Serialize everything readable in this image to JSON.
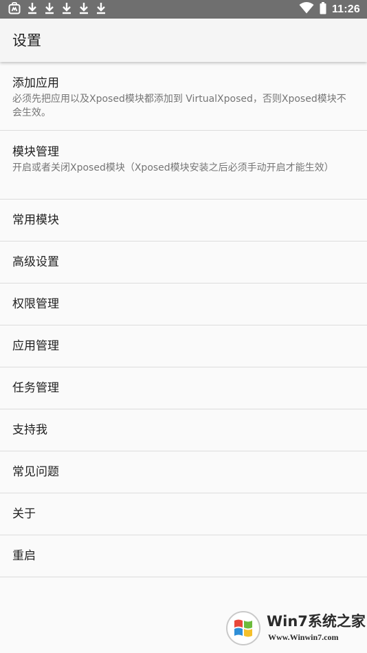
{
  "status_bar": {
    "time": "11:26",
    "icons": [
      "app-notification-icon",
      "download-icon",
      "download-icon",
      "download-icon",
      "download-icon",
      "download-icon",
      "wifi-icon",
      "battery-icon"
    ],
    "background_color": "#6f6f6f"
  },
  "app_bar": {
    "title": "设置"
  },
  "settings": {
    "items": [
      {
        "title": "添加应用",
        "summary": "必须先把应用以及Xposed模块都添加到 VirtualXposed，否则Xposed模块不会生效。"
      },
      {
        "title": "模块管理",
        "summary": "开启或者关闭Xposed模块（Xposed模块安装之后必须手动开启才能生效）"
      },
      {
        "title": "常用模块"
      },
      {
        "title": "高级设置"
      },
      {
        "title": "权限管理"
      },
      {
        "title": "应用管理"
      },
      {
        "title": "任务管理"
      },
      {
        "title": "支持我"
      },
      {
        "title": "常见问题"
      },
      {
        "title": "关于"
      },
      {
        "title": "重启"
      }
    ]
  },
  "watermark": {
    "brand": "Win7系统之家",
    "url": "Www.Winwin7.com"
  }
}
